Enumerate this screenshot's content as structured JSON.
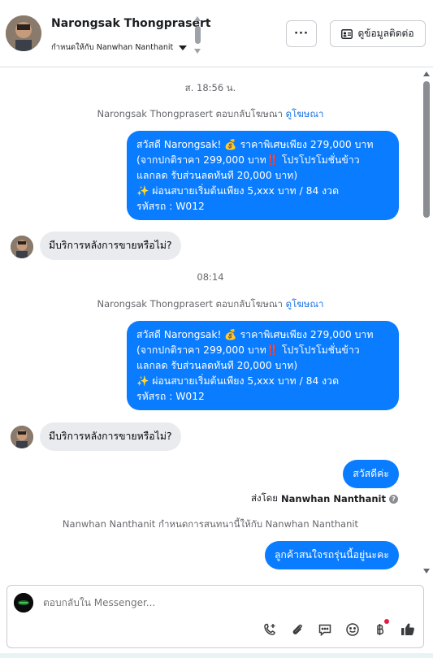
{
  "header": {
    "contact_name": "Narongsak Thongprasert",
    "assigned_to": "กำหนดให้กับ Nanwhan Nanthanit",
    "more_label": "···",
    "contact_info_label": "ดูข้อมูลติดต่อ"
  },
  "messages": {
    "time_1": "ส. 18:56 น.",
    "context_1_text": "Narongsak Thongprasert ตอบกลับโฆษณา",
    "context_1_link": "ดูโฆษณา",
    "promo_1_line1": "สวัสดี Narongsak! 💰 ราคาพิเศษเพียง 279,000 บาท",
    "promo_1_line2": "(จากปกติราคา 299,000 บาท‼️ โปรโปรโมชั่นข้าว",
    "promo_1_line3": "แลกลด รับส่วนลดทันที 20,000 บาท)",
    "promo_1_line4": "✨ ผ่อนสบายเริ่มต้นเพียง 5,xxx บาท / 84 งวด",
    "promo_1_line5": "รหัสรถ : W012",
    "incoming_1": "มีบริการหลังการขายหรือไม่?",
    "time_2": "08:14",
    "context_2_text": "Narongsak Thongprasert ตอบกลับโฆษณา",
    "context_2_link": "ดูโฆษณา",
    "promo_2_line1": "สวัสดี Narongsak! 💰 ราคาพิเศษเพียง 279,000 บาท",
    "promo_2_line2": "(จากปกติราคา 299,000 บาท‼️ โปรโปรโมชั่นข้าว",
    "promo_2_line3": "แลกลด รับส่วนลดทันที 20,000 บาท)",
    "promo_2_line4": "✨ ผ่อนสบายเริ่มต้นเพียง 5,xxx บาท / 84 งวด",
    "promo_2_line5": "รหัสรถ : W012",
    "incoming_2": "มีบริการหลังการขายหรือไม่?",
    "outgoing_greeting": "สวัสดีค่ะ",
    "sent_by_prefix": "ส่งโดย",
    "sent_by_name": "Nanwhan Nanthanit",
    "assignment_notice": "Nanwhan Nanthanit กำหนดการสนทนานี้ให้กับ Nanwhan Nanthanit",
    "outgoing_question": "ลูกค้าสนใจรถรุ่นนี้อยู่นะคะ"
  },
  "composer": {
    "placeholder": "ตอบกลับใน Messenger..."
  },
  "icons": {
    "tools": [
      "add-contact-icon",
      "attachment-icon",
      "saved-reply-icon",
      "emoji-icon",
      "baht-payment-icon",
      "like-icon"
    ]
  },
  "colors": {
    "accent": "#0a7cff",
    "incoming_bubble": "#e9ebee",
    "link": "#1b74e4",
    "notification_dot": "#e41e3f"
  }
}
